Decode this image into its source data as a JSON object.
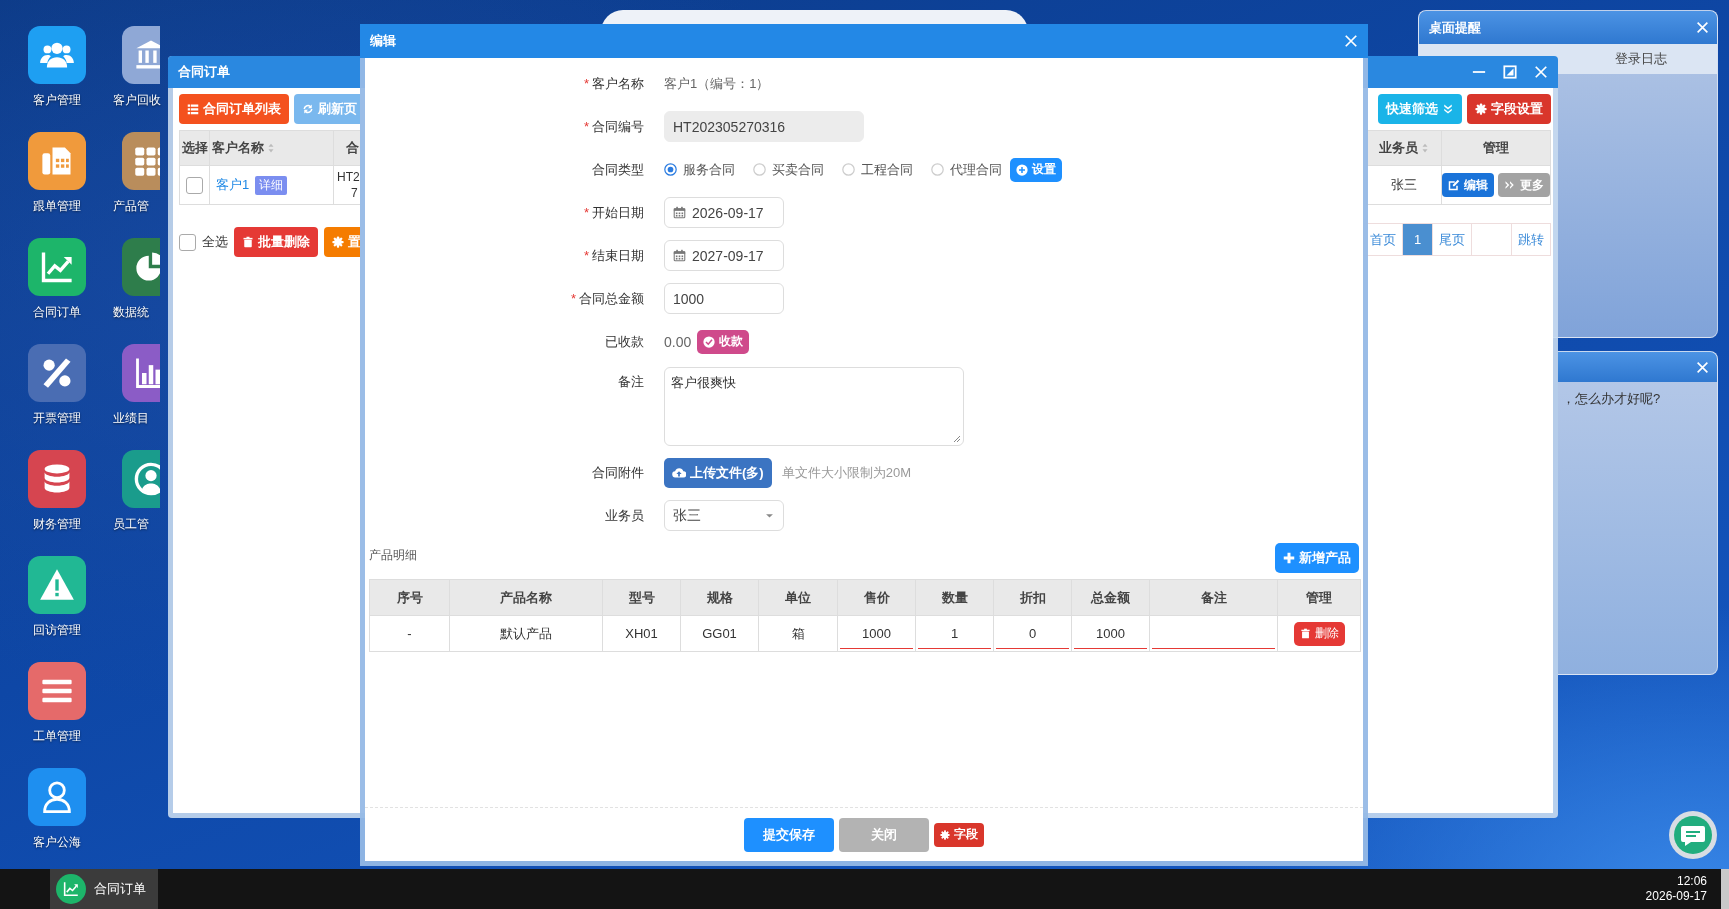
{
  "desktop_icons": [
    {
      "label": "客户管理",
      "kind": "users",
      "color": "#1e9ff2"
    },
    {
      "label": "跟单管理",
      "kind": "fax",
      "color": "#f09a3c"
    },
    {
      "label": "合同订单",
      "kind": "line-chart",
      "color": "#1db56a"
    },
    {
      "label": "开票管理",
      "kind": "percent",
      "color": "#4a6db3"
    },
    {
      "label": "财务管理",
      "kind": "database",
      "color": "#d64550"
    },
    {
      "label": "回访管理",
      "kind": "warning",
      "color": "#21b894"
    },
    {
      "label": "工单管理",
      "kind": "list",
      "color": "#e56a6a"
    },
    {
      "label": "客户公海",
      "kind": "user",
      "color": "#1e8ff0"
    },
    {
      "label": "客户回收",
      "kind": "bank",
      "color": "#8fa8d6"
    },
    {
      "label": "产品管",
      "kind": "grid",
      "color": "#b98d5c"
    },
    {
      "label": "数据统",
      "kind": "pie",
      "color": "#2e7d4b"
    },
    {
      "label": "业绩目",
      "kind": "bars",
      "color": "#8b5cc6"
    },
    {
      "label": "员工管",
      "kind": "person",
      "color": "#1a9c8c"
    }
  ],
  "reminder_window": {
    "title": "桌面提醒",
    "tabs": [
      "登录日志"
    ]
  },
  "message_window": {
    "text": "，怎么办才好呢?"
  },
  "order_window": {
    "title": "合同订单",
    "left_toolbar": [
      {
        "label": "合同订单列表",
        "kind": "list"
      },
      {
        "label": "刷新页",
        "kind": "refresh"
      }
    ],
    "left_columns": [
      {
        "label": "选择"
      },
      {
        "label": "客户名称",
        "sortable": true
      },
      {
        "label": "合"
      }
    ],
    "left_row": {
      "checked": false,
      "customer": "客户1",
      "detail": "详细",
      "contract_no": [
        "HT2",
        "7"
      ]
    },
    "select_all": {
      "label": "全选",
      "checked": false
    },
    "bulk_buttons": [
      {
        "label": "批量删除",
        "kind": "delete"
      },
      {
        "label": "置",
        "kind": "settings"
      }
    ],
    "right_toolbar": [
      {
        "label": "快速筛选",
        "kind": "filter"
      },
      {
        "label": "字段设置",
        "kind": "fields"
      }
    ],
    "right_columns": [
      {
        "label": "业务员",
        "sortable": true
      },
      {
        "label": "管理",
        "sortable": false
      }
    ],
    "right_row": {
      "salesperson": "张三",
      "actions": [
        {
          "label": "编辑",
          "kind": "edit"
        },
        {
          "label": "更多",
          "kind": "more"
        }
      ]
    },
    "pagination": [
      {
        "kind": "page",
        "label": "首页",
        "selected": false
      },
      {
        "kind": "page",
        "label": "1",
        "selected": true
      },
      {
        "kind": "page",
        "label": "尾页",
        "selected": false
      },
      {
        "kind": "input"
      },
      {
        "kind": "jump",
        "label": "跳转"
      }
    ]
  },
  "edit_dialog": {
    "title": "编辑",
    "fields": [
      {
        "kind": "text",
        "mark": "*",
        "label": "客户名称",
        "value": "客户1（编号：1）"
      },
      {
        "kind": "input",
        "mark": "*",
        "label": "合同编号",
        "value": "HT202305270316",
        "disabled": true
      },
      {
        "kind": "radio",
        "label": "合同类型",
        "options": [
          {
            "label": "服务合同",
            "selected": true
          },
          {
            "label": "买卖合同",
            "selected": false
          },
          {
            "label": "工程合同",
            "selected": false
          },
          {
            "label": "代理合同",
            "selected": false
          }
        ],
        "button": "设置"
      },
      {
        "kind": "date",
        "mark": "*",
        "label": "开始日期",
        "value": "2026-09-17"
      },
      {
        "kind": "date",
        "mark": "*",
        "label": "结束日期",
        "value": "2027-09-17"
      },
      {
        "kind": "input",
        "mark": "*",
        "label": "合同总金额",
        "value": "1000",
        "disabled": false
      },
      {
        "kind": "amount",
        "label": "已收款",
        "value": "0.00",
        "button": "收款"
      },
      {
        "kind": "textarea",
        "label": "备注",
        "value": "客户很爽快"
      },
      {
        "kind": "upload",
        "label": "合同附件",
        "button": "上传文件(多)",
        "hint": "单文件大小限制为20M"
      },
      {
        "kind": "select",
        "label": "业务员",
        "value": "张三"
      }
    ],
    "products": {
      "title": "产品明细",
      "add_button": "新增产品",
      "columns": [
        {
          "label": "序号",
          "kind": "text"
        },
        {
          "label": "产品名称",
          "kind": "text"
        },
        {
          "label": "型号",
          "kind": "text"
        },
        {
          "label": "规格",
          "kind": "text"
        },
        {
          "label": "单位",
          "kind": "text"
        },
        {
          "label": "售价",
          "kind": "input"
        },
        {
          "label": "数量",
          "kind": "input"
        },
        {
          "label": "折扣",
          "kind": "input"
        },
        {
          "label": "总金额",
          "kind": "input"
        },
        {
          "label": "备注",
          "kind": "empty_input"
        },
        {
          "label": "管理",
          "kind": "action"
        }
      ],
      "rows": [
        {
          "cells": [
            "-",
            "默认产品",
            "XH01",
            "GG01",
            "箱",
            "1000",
            "1",
            "0",
            "1000"
          ],
          "delete_button": "删除"
        }
      ]
    },
    "footer_buttons": [
      {
        "label": "提交保存",
        "kind": "primary"
      },
      {
        "label": "关闭",
        "kind": "secondary"
      },
      {
        "label": "字段",
        "kind": "fields"
      }
    ]
  },
  "taskbar": {
    "apps": [
      {
        "label": "合同订单",
        "kind": "line-chart",
        "selected": true
      }
    ],
    "time": "12:06",
    "date": "2026-09-17"
  }
}
